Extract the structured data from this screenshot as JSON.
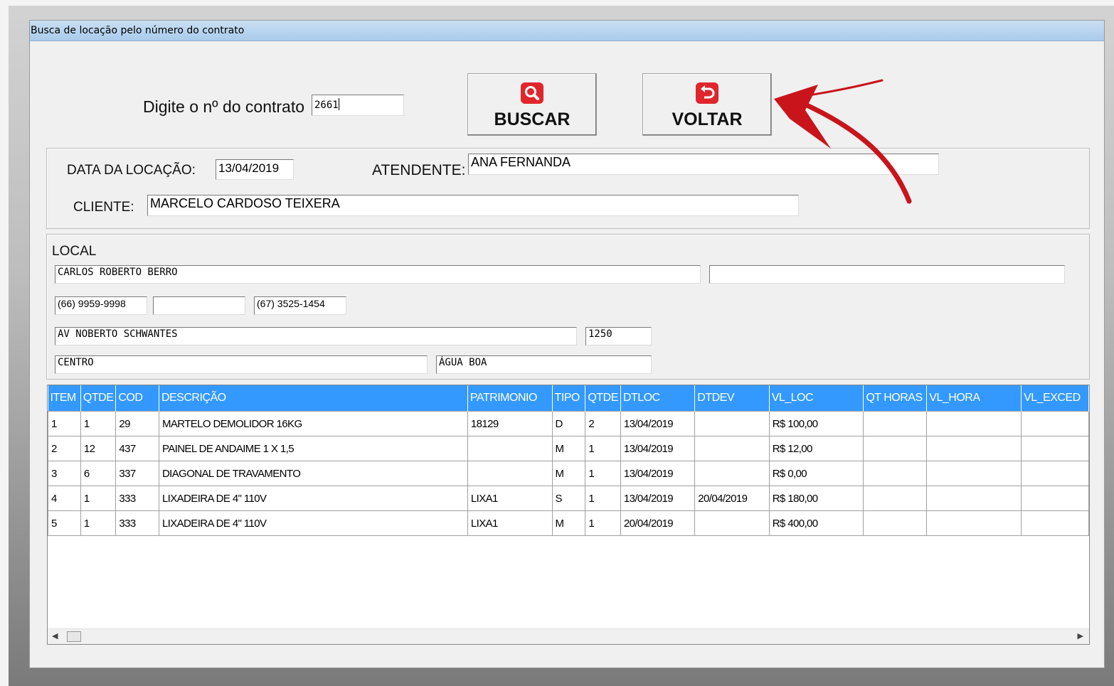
{
  "window": {
    "title": "Busca de locação pelo número do contrato"
  },
  "search": {
    "label": "Digite o nº do contrato",
    "value": "2661",
    "buscar_label": "BUSCAR",
    "voltar_label": "VOLTAR"
  },
  "info": {
    "data_label": "DATA DA LOCAÇÃO:",
    "data_value": "13/04/2019",
    "atendente_label": "ATENDENTE:",
    "atendente_value": "ANA FERNANDA",
    "cliente_label": "CLIENTE:",
    "cliente_value": "MARCELO CARDOSO TEIXERA"
  },
  "local": {
    "label": "LOCAL",
    "name": "CARLOS ROBERTO BERRO",
    "name2": "",
    "phone1": "(66) 9959-9998",
    "phone2": "",
    "phone3": "(67) 3525-1454",
    "street": "AV NOBERTO SCHWANTES",
    "number": "1250",
    "district": "CENTRO",
    "city": "ÁGUA BOA"
  },
  "grid": {
    "columns": [
      "ITEM",
      "QTDE",
      "COD",
      "DESCRIÇÃO",
      "PATRIMONIO",
      "TIPO",
      "QTDE",
      "DTLOC",
      "DTDEV",
      "VL_LOC",
      "QT HORAS",
      "VL_HORA",
      "VL_EXCED"
    ],
    "rows": [
      [
        "1",
        "1",
        "29",
        "MARTELO DEMOLIDOR 16KG",
        "18129",
        "D",
        "2",
        "13/04/2019",
        "",
        "R$ 100,00",
        "",
        "",
        ""
      ],
      [
        "2",
        "12",
        "437",
        "PAINEL DE ANDAIME 1 X 1,5",
        "",
        "M",
        "1",
        "13/04/2019",
        "",
        "R$ 12,00",
        "",
        "",
        ""
      ],
      [
        "3",
        "6",
        "337",
        "DIAGONAL DE TRAVAMENTO",
        "",
        "M",
        "1",
        "13/04/2019",
        "",
        "R$ 0,00",
        "",
        "",
        ""
      ],
      [
        "4",
        "1",
        "333",
        "LIXADEIRA DE 4\" 110V",
        "LIXA1",
        "S",
        "1",
        "13/04/2019",
        "20/04/2019",
        "R$ 180,00",
        "",
        "",
        ""
      ],
      [
        "5",
        "1",
        "333",
        "LIXADEIRA DE 4\" 110V",
        "LIXA1",
        "M",
        "1",
        "20/04/2019",
        "",
        "R$ 400,00",
        "",
        "",
        ""
      ]
    ]
  },
  "icons": {
    "buscar": "search-icon",
    "voltar": "return-icon",
    "annotation": "red-arrow-annotation"
  },
  "colors": {
    "header": "#3399ff",
    "accent": "#e0262c",
    "titlebar": "#aacbeb"
  }
}
